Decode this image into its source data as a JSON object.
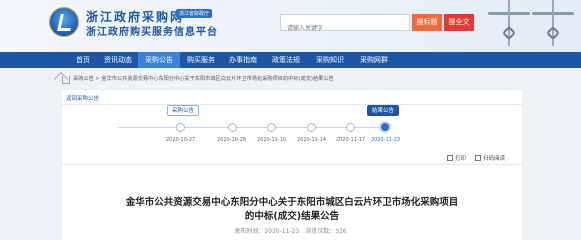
{
  "header": {
    "title": "浙江政府采购网",
    "badge": "浙江省财政厅",
    "subtitle": "浙江政府购买服务信息平台",
    "search_placeholder": "请输入关键字",
    "search_button": "搜标题",
    "fulltext_button": "搜全文"
  },
  "nav": {
    "items": [
      {
        "label": "首页"
      },
      {
        "label": "资讯动态"
      },
      {
        "label": "采购公告"
      },
      {
        "label": "购买服务"
      },
      {
        "label": "办事指南"
      },
      {
        "label": "政策法规"
      },
      {
        "label": "采购知识"
      },
      {
        "label": "采购网群"
      }
    ],
    "active_index": 2
  },
  "breadcrumb": {
    "text": "采购公告 > 金华市公共资源交易中心东阳分中心关于东阳市城区白云片环卫市场化采购项目的中标(成交)结果公告"
  },
  "panel": {
    "back_link": "返回采购公告",
    "timeline": [
      {
        "label": "采购公告",
        "date": "2020-10-27"
      },
      {
        "label": "",
        "date": "2020-10-28"
      },
      {
        "label": "",
        "date": "2020-11-10"
      },
      {
        "label": "",
        "date": "2020-11-14"
      },
      {
        "label": "",
        "date": "2020-11-17"
      },
      {
        "label": "结果公告",
        "date": "2020-11-23",
        "current": true
      }
    ],
    "tools": {
      "print": "打印",
      "qr": "扫码阅读"
    },
    "article_title": "金华市公共资源交易中心东阳分中心关于东阳市城区白云片环卫市场化采购项目的中标(成交)结果公告",
    "meta": "发布时间：2020-11-23　浏览次数：326"
  },
  "colors": {
    "brand_blue": "#1c56a4",
    "nav_active": "#3b82dc",
    "search_orange": "#ef6c38",
    "fulltext_red": "#e53935"
  }
}
